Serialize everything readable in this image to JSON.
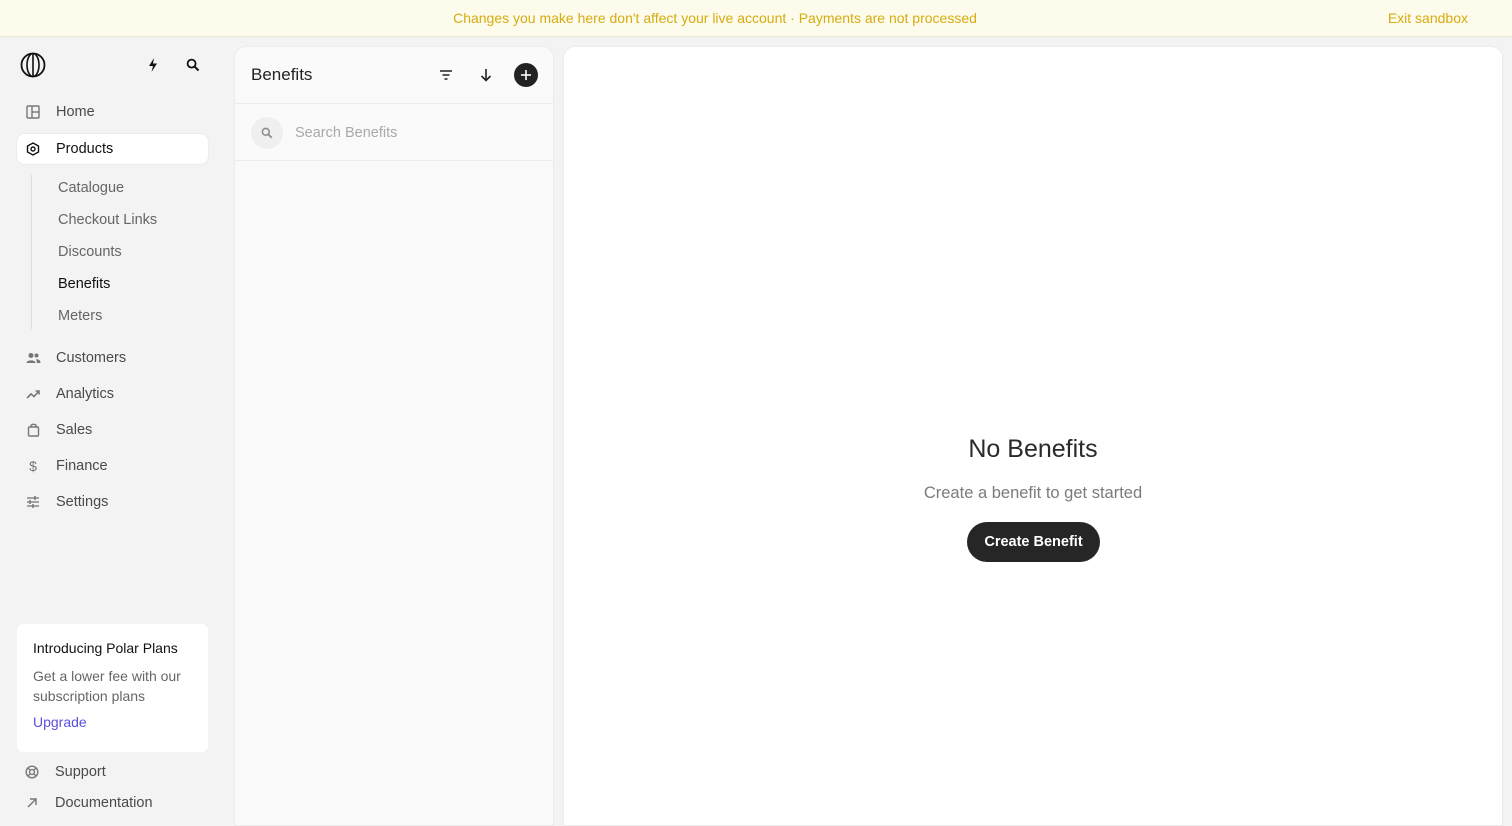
{
  "banner": {
    "message": "Changes you make here don't affect your live account · Payments are not processed",
    "exit_label": "Exit sandbox",
    "color": "#d5ac12"
  },
  "sidebar": {
    "logo_icon": "polar-logo-icon",
    "top_icons": [
      "bolt-icon",
      "search-icon"
    ],
    "nav": [
      {
        "label": "Home",
        "icon": "grid-icon"
      },
      {
        "label": "Products",
        "icon": "hexagon-icon",
        "active": true
      },
      {
        "label": "Customers",
        "icon": "people-icon"
      },
      {
        "label": "Analytics",
        "icon": "trending-up-icon"
      },
      {
        "label": "Sales",
        "icon": "shopping-bag-icon"
      },
      {
        "label": "Finance",
        "icon": "dollar-icon"
      },
      {
        "label": "Settings",
        "icon": "sliders-icon"
      }
    ],
    "subnav": [
      {
        "label": "Catalogue"
      },
      {
        "label": "Checkout Links"
      },
      {
        "label": "Discounts"
      },
      {
        "label": "Benefits",
        "current": true
      },
      {
        "label": "Meters"
      }
    ],
    "promo": {
      "title": "Introducing Polar Plans",
      "text": "Get a lower fee with our subscription plans",
      "link": "Upgrade"
    },
    "footer": [
      {
        "label": "Support",
        "icon": "support-icon"
      },
      {
        "label": "Documentation",
        "icon": "arrow-up-right-icon"
      }
    ]
  },
  "list": {
    "title": "Benefits",
    "search_placeholder": "Search Benefits"
  },
  "main": {
    "empty_title": "No Benefits",
    "empty_subtitle": "Create a benefit to get started",
    "create_label": "Create Benefit"
  }
}
